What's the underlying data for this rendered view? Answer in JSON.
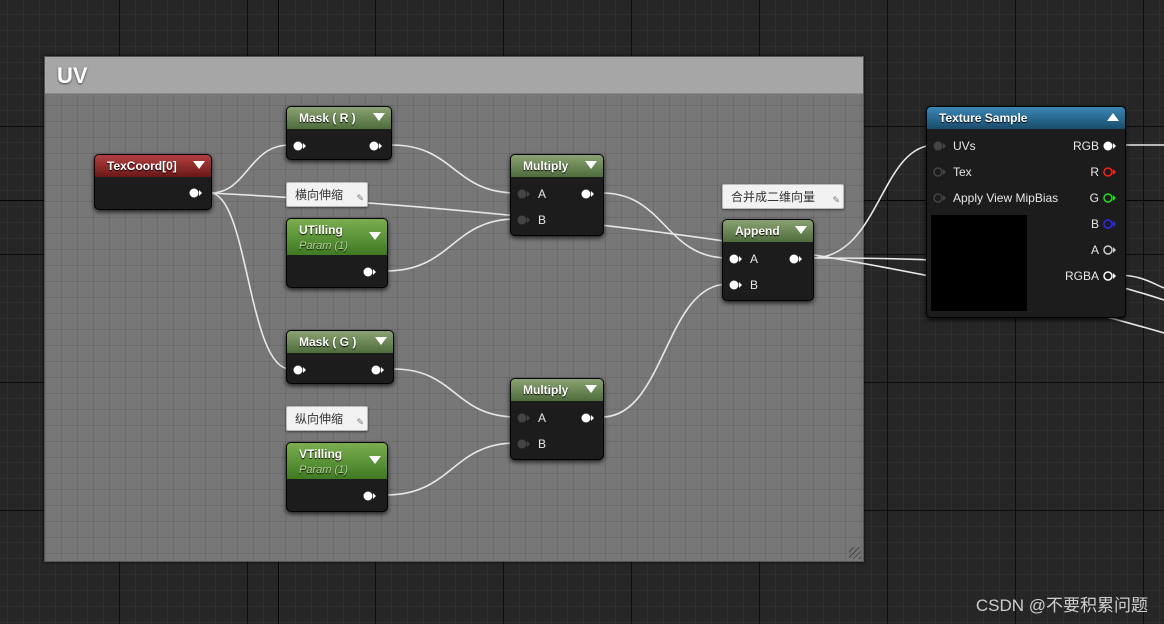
{
  "comment": {
    "title": "UV"
  },
  "notes": {
    "u": "横向伸缩",
    "v": "纵向伸缩",
    "append": "合并成二维向量"
  },
  "nodes": {
    "texcoord": {
      "title": "TexCoord[0]"
    },
    "mask_r": {
      "title": "Mask ( R )"
    },
    "mask_g": {
      "title": "Mask ( G )"
    },
    "utilling": {
      "title": "UTilling",
      "subtitle": "Param (1)"
    },
    "vtilling": {
      "title": "VTilling",
      "subtitle": "Param (1)"
    },
    "multiply1": {
      "title": "Multiply",
      "in_a": "A",
      "in_b": "B"
    },
    "multiply2": {
      "title": "Multiply",
      "in_a": "A",
      "in_b": "B"
    },
    "append": {
      "title": "Append",
      "in_a": "A",
      "in_b": "B"
    },
    "texture": {
      "title": "Texture Sample",
      "inputs": [
        "UVs",
        "Tex",
        "Apply View MipBias"
      ],
      "outputs": [
        "RGB",
        "R",
        "G",
        "B",
        "A",
        "RGBA"
      ]
    }
  },
  "colors": {
    "wire": "#e8e8e8",
    "pin_r": "#ff2020",
    "pin_g": "#22dd22",
    "pin_b": "#2a2aff",
    "pin_default": "#ffffff"
  },
  "watermark": "CSDN @不要积累问题"
}
